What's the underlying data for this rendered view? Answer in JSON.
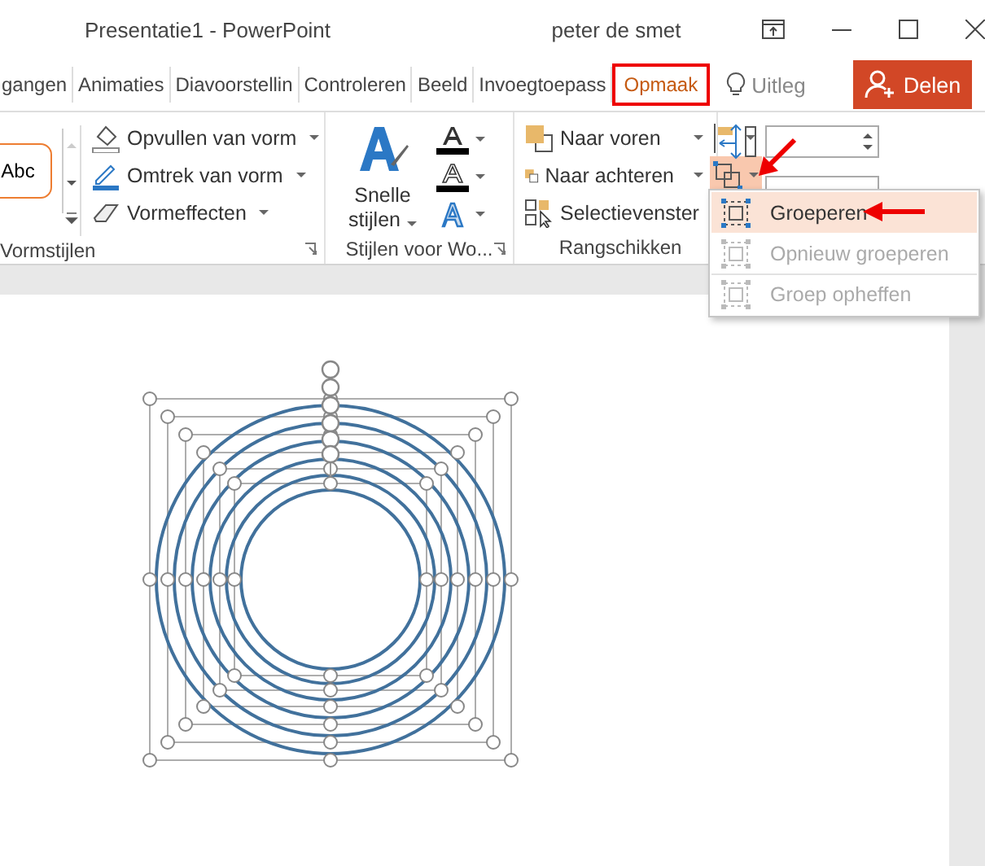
{
  "window": {
    "title": "Presentatie1 - PowerPoint",
    "user": "peter de smet"
  },
  "tabs": [
    {
      "label": "gangen",
      "selected": false
    },
    {
      "label": "Animaties",
      "selected": false
    },
    {
      "label": "Diavoorstellin",
      "selected": false
    },
    {
      "label": "Controleren",
      "selected": false
    },
    {
      "label": "Beeld",
      "selected": false
    },
    {
      "label": "Invoegtoepass",
      "selected": false
    },
    {
      "label": "Opmaak",
      "selected": true
    }
  ],
  "tell_me": "Uitleg",
  "share": "Delen",
  "shape_styles": {
    "label": "Vormstijlen",
    "sample": "Abc",
    "commands": [
      "Opvullen van vorm",
      "Omtrek van vorm",
      "Vormeffecten"
    ]
  },
  "wordart_styles": {
    "label": "Stijlen voor Wo...",
    "quick_styles": "Snelle stijlen"
  },
  "arrange": {
    "label": "Rangschikken",
    "commands": [
      "Naar voren",
      "Naar achteren",
      "Selectievenster"
    ],
    "group_menu_open": true
  },
  "group_menu": [
    {
      "label": "Groeperen",
      "selected": true,
      "disabled": false
    },
    {
      "label": "Opnieuw groeperen",
      "selected": false,
      "disabled": true
    },
    {
      "label": "Groep opheffen",
      "selected": false,
      "disabled": true
    }
  ]
}
